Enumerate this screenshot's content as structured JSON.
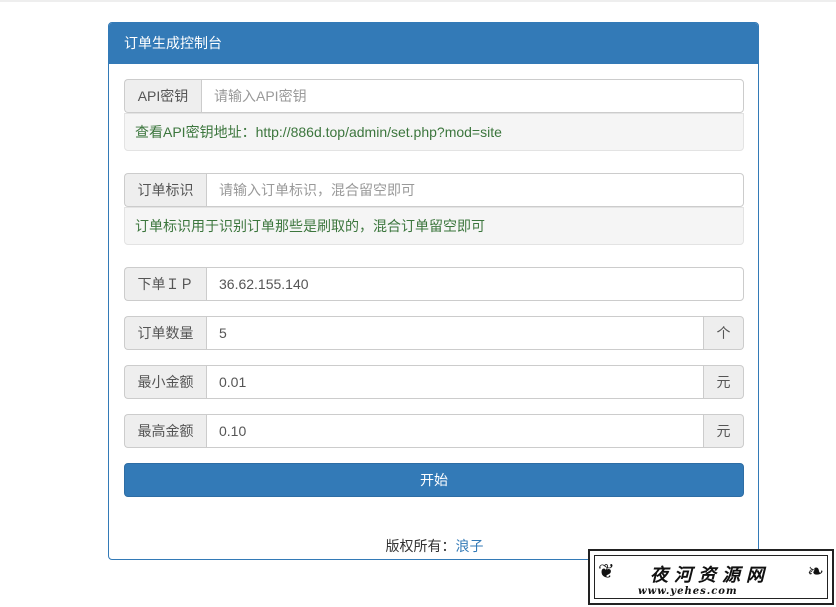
{
  "panel": {
    "title": "订单生成控制台"
  },
  "api_key": {
    "label": "API密钥",
    "placeholder": "请输入API密钥",
    "value": "",
    "help": "查看API密钥地址：http://886d.top/admin/set.php?mod=site"
  },
  "order_tag": {
    "label": "订单标识",
    "placeholder": "请输入订单标识，混合留空即可",
    "value": "",
    "help": "订单标识用于识别订单那些是刷取的，混合订单留空即可"
  },
  "order_ip": {
    "label": "下单ＩＰ",
    "value": "36.62.155.140"
  },
  "order_count": {
    "label": "订单数量",
    "value": "5",
    "unit": "个"
  },
  "min_amount": {
    "label": "最小金额",
    "value": "0.01",
    "unit": "元"
  },
  "max_amount": {
    "label": "最高金额",
    "value": "0.10",
    "unit": "元"
  },
  "start_button": {
    "label": "开始"
  },
  "footer": {
    "copyright_prefix": "版权所有：",
    "author": "浪子"
  },
  "watermark": {
    "title": "夜河资源网",
    "url": "www.yehes.com"
  },
  "colors": {
    "primary": "#337ab7",
    "help_text": "#3c763d"
  }
}
